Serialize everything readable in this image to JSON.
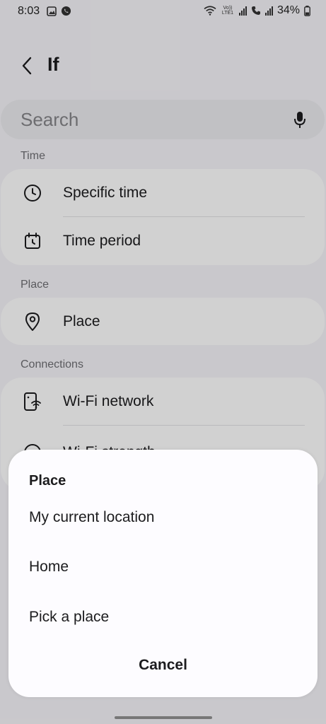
{
  "status_bar": {
    "time": "8:03",
    "lte_label": "Vo)) LTE1",
    "battery": "34%"
  },
  "header": {
    "title": "If"
  },
  "search": {
    "placeholder": "Search"
  },
  "sections": {
    "time": {
      "label": "Time",
      "items": [
        {
          "label": "Specific time",
          "icon": "clock-icon"
        },
        {
          "label": "Time period",
          "icon": "calendar-clock-icon"
        }
      ]
    },
    "place": {
      "label": "Place",
      "items": [
        {
          "label": "Place",
          "icon": "location-pin-icon"
        }
      ]
    },
    "connections": {
      "label": "Connections",
      "items": [
        {
          "label": "Wi-Fi network",
          "icon": "wifi-phone-icon"
        },
        {
          "label": "Wi-Fi strength",
          "icon": "wifi-strength-icon"
        }
      ]
    }
  },
  "sheet": {
    "title": "Place",
    "options": [
      {
        "label": "My current location"
      },
      {
        "label": "Home"
      },
      {
        "label": "Pick a place"
      }
    ],
    "cancel_label": "Cancel"
  }
}
